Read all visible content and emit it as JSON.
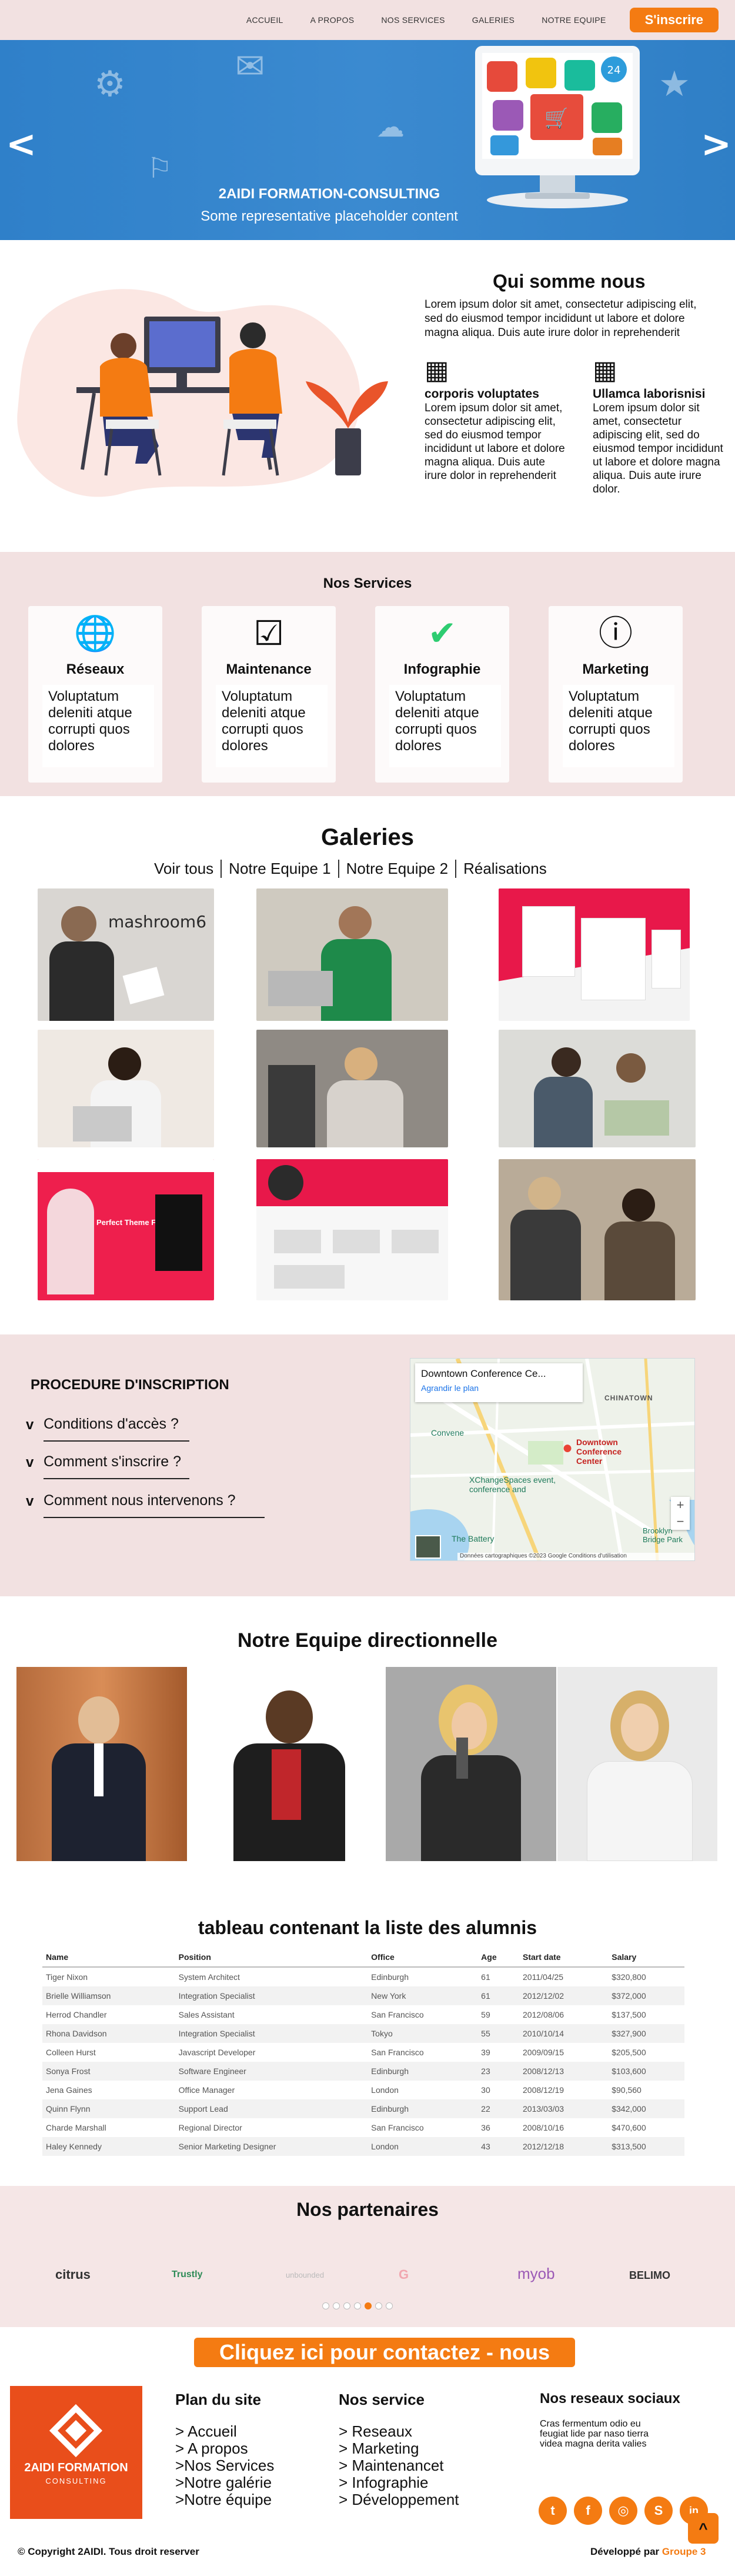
{
  "nav": {
    "links": [
      "ACCUEIL",
      "A PROPOS",
      "NOS SERVICES",
      "GALERIES",
      "NOTRE EQUIPE"
    ],
    "signup": "S'inscrire"
  },
  "hero": {
    "prev": "<",
    "next": ">",
    "title": "2AIDI FORMATION-CONSULTING",
    "subtitle": "Some representative placeholder content"
  },
  "about": {
    "title": "Qui somme nous",
    "intro": "Lorem ipsum dolor sit amet, consectetur adipiscing elit, sed do eiusmod tempor incididunt ut labore et dolore magna aliqua. Duis aute irure dolor in reprehenderit",
    "features": [
      {
        "title": "corporis voluptates",
        "text": "Lorem ipsum dolor sit amet, consectetur adipiscing elit, sed do eiusmod tempor incididunt ut labore et dolore magna aliqua. Duis aute irure dolor in reprehenderit"
      },
      {
        "title": "Ullamca laborisnisi",
        "text": "Lorem ipsum dolor sit amet, consectetur adipiscing elit, sed do eiusmod tempor incididunt ut labore et dolore magna aliqua. Duis aute irure dolor."
      }
    ]
  },
  "services": {
    "title": "Nos Services",
    "items": [
      {
        "name": "Réseaux",
        "text": "Voluptatum deleniti atque corrupti quos dolores",
        "icon": "globe-icon"
      },
      {
        "name": "Maintenance",
        "text": "Voluptatum deleniti atque corrupti quos dolores",
        "icon": "checkbox-icon"
      },
      {
        "name": "Infographie",
        "text": "Voluptatum deleniti atque corrupti quos dolores",
        "icon": "check-circle-icon"
      },
      {
        "name": "Marketing",
        "text": "Voluptatum deleniti atque corrupti quos dolores",
        "icon": "alert-circle-icon"
      }
    ]
  },
  "gallery": {
    "title": "Galeries",
    "filters": [
      "Voir tous",
      "Notre Equipe 1",
      "Notre Equipe 2",
      "Réalisations"
    ],
    "photo1_text": "mashroom6",
    "photo7_text": "Perfect Theme For"
  },
  "procedure": {
    "title": "PROCEDURE D'INSCRIPTION",
    "steps": [
      "Conditions d'accès ?",
      "Comment s'inscrire ?",
      "Comment nous intervenons ?"
    ],
    "map": {
      "place": "Downtown Conference Ce...",
      "link": "Agrandir le plan",
      "marker": "Downtown Conference Center",
      "poi1": "Chinatown",
      "poi2": "XChangeSpaces event, conference and",
      "poi3": "The Battery",
      "poi4": "Brooklyn Bridge Park",
      "poi5": "Convene",
      "credits": "Données cartographiques ©2023 Google   Conditions d'utilisation",
      "zoom_in": "+",
      "zoom_out": "−"
    }
  },
  "team": {
    "title": "Notre Equipe directionnelle"
  },
  "alumni": {
    "title": "tableau contenant la liste des alumnis",
    "headers": [
      "Name",
      "Position",
      "Office",
      "Age",
      "Start date",
      "Salary"
    ],
    "rows": [
      [
        "Tiger Nixon",
        "System Architect",
        "Edinburgh",
        "61",
        "2011/04/25",
        "$320,800"
      ],
      [
        "Brielle Williamson",
        "Integration Specialist",
        "New York",
        "61",
        "2012/12/02",
        "$372,000"
      ],
      [
        "Herrod Chandler",
        "Sales Assistant",
        "San Francisco",
        "59",
        "2012/08/06",
        "$137,500"
      ],
      [
        "Rhona Davidson",
        "Integration Specialist",
        "Tokyo",
        "55",
        "2010/10/14",
        "$327,900"
      ],
      [
        "Colleen Hurst",
        "Javascript Developer",
        "San Francisco",
        "39",
        "2009/09/15",
        "$205,500"
      ],
      [
        "Sonya Frost",
        "Software Engineer",
        "Edinburgh",
        "23",
        "2008/12/13",
        "$103,600"
      ],
      [
        "Jena Gaines",
        "Office Manager",
        "London",
        "30",
        "2008/12/19",
        "$90,560"
      ],
      [
        "Quinn Flynn",
        "Support Lead",
        "Edinburgh",
        "22",
        "2013/03/03",
        "$342,000"
      ],
      [
        "Charde Marshall",
        "Regional Director",
        "San Francisco",
        "36",
        "2008/10/16",
        "$470,600"
      ],
      [
        "Haley Kennedy",
        "Senior Marketing Designer",
        "London",
        "43",
        "2012/12/18",
        "$313,500"
      ]
    ]
  },
  "partners": {
    "title": "Nos partenaires",
    "logos": [
      "citrus",
      "Trustly",
      "unbounded",
      "G",
      "myob",
      "BELIMO"
    ]
  },
  "footer": {
    "cta": "Cliquez ici pour contactez - nous",
    "logo_text": "2AIDI FORMATION",
    "logo_sub": "CONSULTING",
    "plan": {
      "title": "Plan du site",
      "items": [
        "> Accueil",
        "> A propos",
        ">Nos Services",
        ">Notre galérie",
        ">Notre équipe"
      ]
    },
    "service": {
      "title": "Nos service",
      "items": [
        "> Reseaux",
        "> Marketing",
        "> Maintenancet",
        "> Infographie",
        "> Développement"
      ]
    },
    "social": {
      "title": "Nos reseaux sociaux",
      "text": "Cras fermentum odio eu feugiat lide par naso tierra videa magna derita valies",
      "icons": [
        "t",
        "f",
        "◎",
        "S",
        "in"
      ]
    },
    "totop": "^",
    "copyright": "© Copyright 2AIDI. Tous droit reserver",
    "dev_prefix": "Développé par ",
    "dev_name": "Groupe 3"
  },
  "colors": {
    "accent": "#f47b12",
    "pink_bg": "#f2e1e1",
    "hero_blue": "#3384cc"
  }
}
